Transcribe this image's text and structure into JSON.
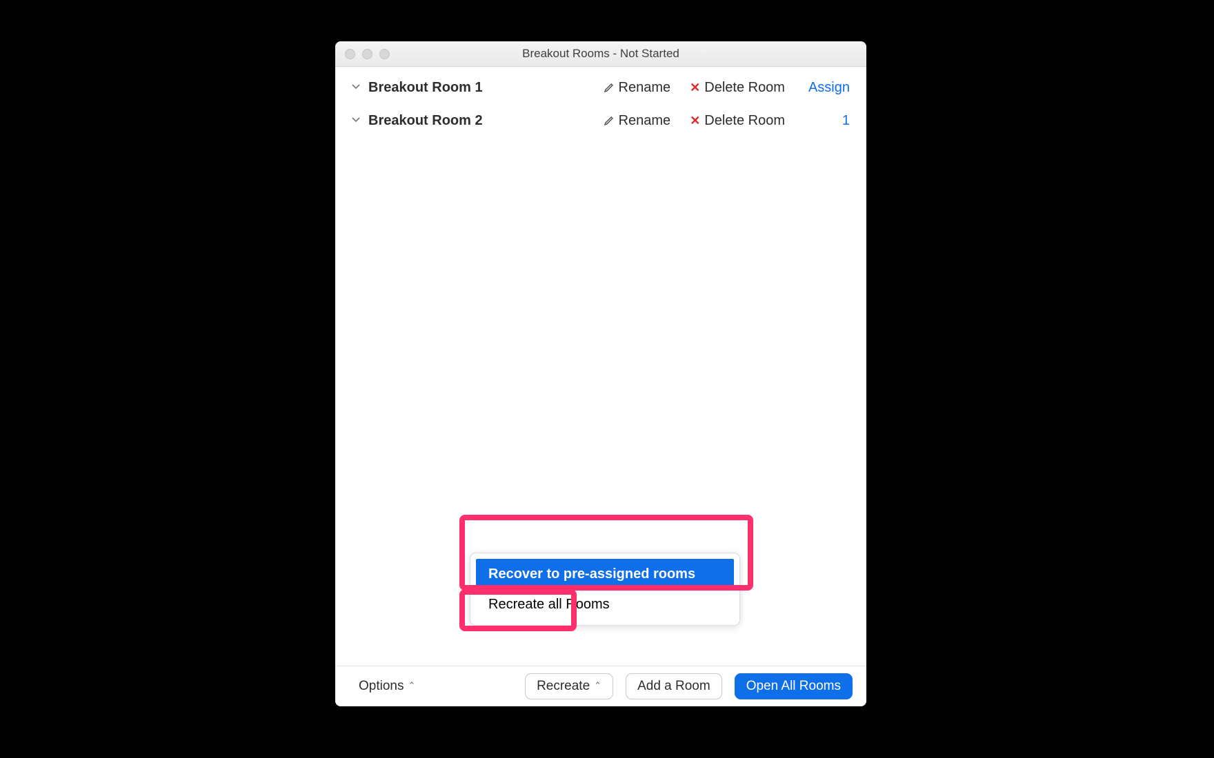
{
  "window": {
    "title": "Breakout Rooms - Not Started"
  },
  "rooms": [
    {
      "name": "Breakout Room 1",
      "rename_label": "Rename",
      "delete_label": "Delete Room",
      "assign_label": "Assign"
    },
    {
      "name": "Breakout Room 2",
      "rename_label": "Rename",
      "delete_label": "Delete Room",
      "assign_label": "1"
    }
  ],
  "popup": {
    "recover_label": "Recover to pre-assigned rooms",
    "recreate_all_label": "Recreate all Rooms"
  },
  "bottom": {
    "options_label": "Options",
    "recreate_label": "Recreate",
    "add_room_label": "Add a Room",
    "open_all_label": "Open All Rooms"
  },
  "colors": {
    "accent": "#0e6fe8",
    "danger": "#e02828",
    "highlight_annotation": "#ff2f6d"
  }
}
